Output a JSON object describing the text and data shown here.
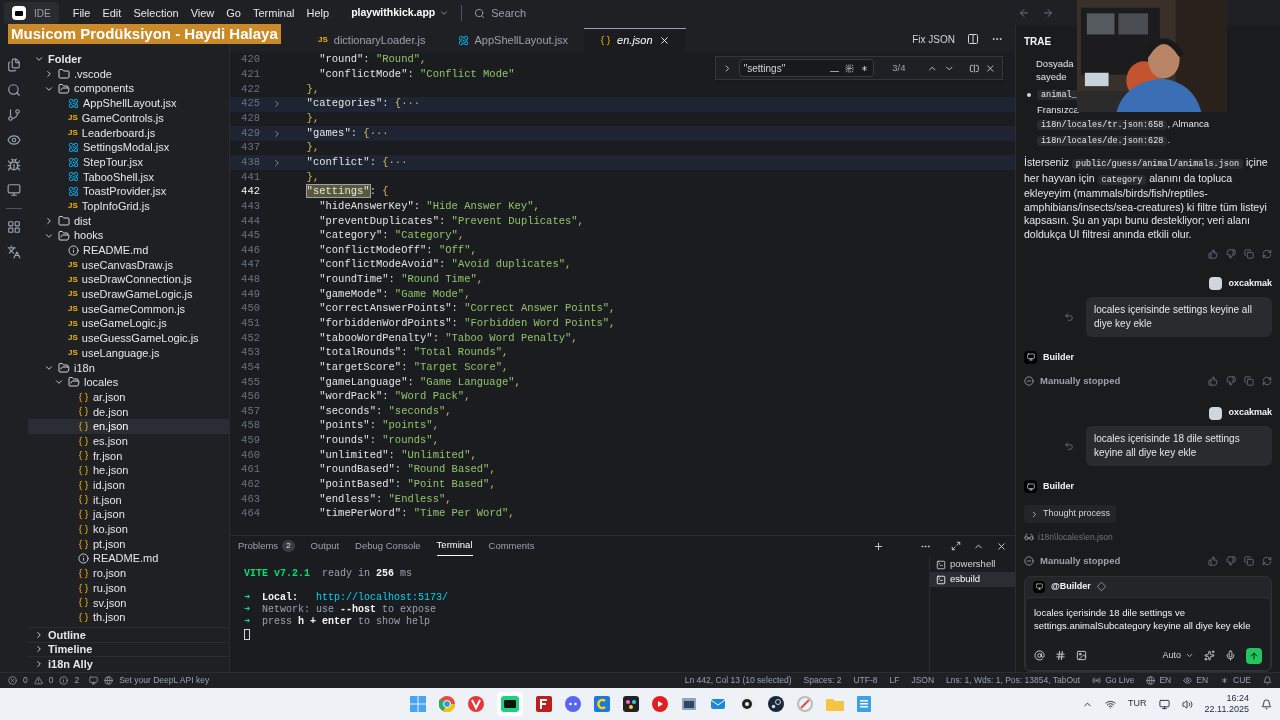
{
  "menubar": {
    "app": "IDE",
    "menus": [
      "File",
      "Edit",
      "Selection",
      "View",
      "Go",
      "Terminal",
      "Help"
    ],
    "project": "playwithkick.app",
    "search_placeholder": "Search"
  },
  "overlay_banner": "Musicom Prodüksiyon - Haydi Halaya",
  "explorer": {
    "tree": [
      {
        "label": "Folder",
        "kind": "root",
        "expanded": true,
        "selected": false,
        "children": [
          {
            "label": ".vscode",
            "kind": "folder",
            "expanded": false,
            "selected": false
          },
          {
            "label": "components",
            "kind": "folder",
            "expanded": true,
            "selected": false,
            "children": [
              {
                "label": "AppShellLayout.jsx",
                "kind": "jsx",
                "selected": false
              },
              {
                "label": "GameControls.js",
                "kind": "js",
                "icon_text": "JS",
                "selected": false
              },
              {
                "label": "Leaderboard.js",
                "kind": "js",
                "icon_text": "JS",
                "selected": false
              },
              {
                "label": "SettingsModal.jsx",
                "kind": "jsx",
                "selected": false
              },
              {
                "label": "StepTour.jsx",
                "kind": "jsx",
                "selected": false
              },
              {
                "label": "TabooShell.jsx",
                "kind": "jsx",
                "selected": false
              },
              {
                "label": "ToastProvider.jsx",
                "kind": "jsx",
                "selected": false
              },
              {
                "label": "TopInfoGrid.js",
                "kind": "js",
                "icon_text": "JS",
                "selected": false
              }
            ]
          },
          {
            "label": "dist",
            "kind": "folder",
            "expanded": false,
            "selected": false
          },
          {
            "label": "hooks",
            "kind": "folder",
            "expanded": true,
            "selected": false,
            "children": [
              {
                "label": "README.md",
                "kind": "md",
                "selected": false
              },
              {
                "label": "useCanvasDraw.js",
                "kind": "js",
                "icon_text": "JS",
                "selected": false
              },
              {
                "label": "useDrawConnection.js",
                "kind": "js",
                "icon_text": "JS",
                "selected": false
              },
              {
                "label": "useDrawGameLogic.js",
                "kind": "js",
                "icon_text": "JS",
                "selected": false
              },
              {
                "label": "useGameCommon.js",
                "kind": "js",
                "icon_text": "JS",
                "selected": false
              },
              {
                "label": "useGameLogic.js",
                "kind": "js",
                "icon_text": "JS",
                "selected": false
              },
              {
                "label": "useGuessGameLogic.js",
                "kind": "js",
                "icon_text": "JS",
                "selected": false
              },
              {
                "label": "useLanguage.js",
                "kind": "js",
                "icon_text": "JS",
                "selected": false
              }
            ]
          },
          {
            "label": "i18n",
            "kind": "folder",
            "expanded": true,
            "selected": false,
            "children": [
              {
                "label": "locales",
                "kind": "folder",
                "expanded": true,
                "selected": false,
                "children": [
                  {
                    "label": "ar.json",
                    "kind": "json",
                    "selected": false
                  },
                  {
                    "label": "de.json",
                    "kind": "json",
                    "selected": false
                  },
                  {
                    "label": "en.json",
                    "kind": "json",
                    "selected": true
                  },
                  {
                    "label": "es.json",
                    "kind": "json",
                    "selected": false
                  },
                  {
                    "label": "fr.json",
                    "kind": "json",
                    "selected": false
                  },
                  {
                    "label": "he.json",
                    "kind": "json",
                    "selected": false
                  },
                  {
                    "label": "id.json",
                    "kind": "json",
                    "selected": false
                  },
                  {
                    "label": "it.json",
                    "kind": "json",
                    "selected": false
                  },
                  {
                    "label": "ja.json",
                    "kind": "json",
                    "selected": false
                  },
                  {
                    "label": "ko.json",
                    "kind": "json",
                    "selected": false
                  },
                  {
                    "label": "pt.json",
                    "kind": "json",
                    "selected": false
                  },
                  {
                    "label": "README.md",
                    "kind": "md",
                    "selected": false
                  },
                  {
                    "label": "ro.json",
                    "kind": "json",
                    "selected": false
                  },
                  {
                    "label": "ru.json",
                    "kind": "json",
                    "selected": false
                  },
                  {
                    "label": "sv.json",
                    "kind": "json",
                    "selected": false
                  },
                  {
                    "label": "th.json",
                    "kind": "json",
                    "selected": false
                  }
                ]
              }
            ]
          }
        ]
      }
    ],
    "sections": [
      {
        "label": "Outline",
        "expanded": false
      },
      {
        "label": "Timeline",
        "expanded": false
      },
      {
        "label": "i18n Ally",
        "expanded": false
      }
    ]
  },
  "editor": {
    "tabs": [
      {
        "label": "dictionaryLoader.js",
        "kind": "js",
        "icon_text": "JS",
        "selected": false
      },
      {
        "label": "AppShellLayout.jsx",
        "kind": "jsx",
        "selected": false
      },
      {
        "label": "en.json",
        "kind": "json",
        "selected": true
      }
    ],
    "fix_label": "Fix JSON",
    "find": {
      "value": "\"settings\"",
      "count": "3/4"
    },
    "lines": [
      {
        "num": "420",
        "text": "    \"round\": \"Round\","
      },
      {
        "num": "421",
        "text": "    \"conflictMode\": \"Conflict Mode\""
      },
      {
        "num": "422",
        "text": "  },"
      },
      {
        "num": "425",
        "text": "  \"categories\": {···",
        "folded": true
      },
      {
        "num": "428",
        "text": "  },"
      },
      {
        "num": "429",
        "text": "  \"games\": {···",
        "folded": true
      },
      {
        "num": "437",
        "text": "  },"
      },
      {
        "num": "438",
        "text": "  \"conflict\": {···",
        "folded": true
      },
      {
        "num": "441",
        "text": "  },"
      },
      {
        "num": "442",
        "text": "  \"settings\": {",
        "current": true,
        "match": true
      },
      {
        "num": "443",
        "text": "    \"hideAnswerKey\": \"Hide Answer Key\","
      },
      {
        "num": "444",
        "text": "    \"preventDuplicates\": \"Prevent Duplicates\","
      },
      {
        "num": "445",
        "text": "    \"category\": \"Category\","
      },
      {
        "num": "446",
        "text": "    \"conflictModeOff\": \"Off\","
      },
      {
        "num": "447",
        "text": "    \"conflictModeAvoid\": \"Avoid duplicates\","
      },
      {
        "num": "448",
        "text": "    \"roundTime\": \"Round Time\","
      },
      {
        "num": "449",
        "text": "    \"gameMode\": \"Game Mode\","
      },
      {
        "num": "450",
        "text": "    \"correctAnswerPoints\": \"Correct Answer Points\","
      },
      {
        "num": "451",
        "text": "    \"forbiddenWordPoints\": \"Forbidden Word Points\","
      },
      {
        "num": "452",
        "text": "    \"tabooWordPenalty\": \"Taboo Word Penalty\","
      },
      {
        "num": "453",
        "text": "    \"totalRounds\": \"Total Rounds\","
      },
      {
        "num": "454",
        "text": "    \"targetScore\": \"Target Score\","
      },
      {
        "num": "455",
        "text": "    \"gameLanguage\": \"Game Language\","
      },
      {
        "num": "456",
        "text": "    \"wordPack\": \"Word Pack\","
      },
      {
        "num": "457",
        "text": "    \"seconds\": \"seconds\","
      },
      {
        "num": "458",
        "text": "    \"points\": \"points\","
      },
      {
        "num": "459",
        "text": "    \"rounds\": \"rounds\","
      },
      {
        "num": "460",
        "text": "    \"unlimited\": \"Unlimited\","
      },
      {
        "num": "461",
        "text": "    \"roundBased\": \"Round Based\","
      },
      {
        "num": "462",
        "text": "    \"pointBased\": \"Point Based\","
      },
      {
        "num": "463",
        "text": "    \"endless\": \"Endless\","
      },
      {
        "num": "464",
        "text": "    \"timePerWord\": \"Time Per Word\","
      }
    ]
  },
  "panel": {
    "tabs": [
      {
        "label": "Problems",
        "badge": "2",
        "selected": false
      },
      {
        "label": "Output",
        "selected": false
      },
      {
        "label": "Debug Console",
        "selected": false
      },
      {
        "label": "Terminal",
        "selected": true
      },
      {
        "label": "Comments",
        "selected": false
      }
    ],
    "terminal_lines": [
      [
        {
          "text": "VITE v7.2.1",
          "kind": "accent"
        },
        {
          "text": "  ready in ",
          "kind": "dim"
        },
        {
          "text": "256",
          "kind": "bold"
        },
        {
          "text": " ms",
          "kind": "dim"
        }
      ],
      [
        {
          "text": "➜",
          "kind": "accent"
        },
        {
          "text": "  Local:   ",
          "kind": "bold"
        },
        {
          "text": "http://localhost:5173/",
          "kind": "link"
        }
      ],
      [
        {
          "text": "➜",
          "kind": "accent"
        },
        {
          "text": "  Network: use ",
          "kind": "dim"
        },
        {
          "text": "--host",
          "kind": "bold"
        },
        {
          "text": " to expose",
          "kind": "dim"
        }
      ],
      [
        {
          "text": "➜",
          "kind": "accent"
        },
        {
          "text": "  press ",
          "kind": "dim"
        },
        {
          "text": "h + enter",
          "kind": "bold"
        },
        {
          "text": " to show help",
          "kind": "dim"
        }
      ]
    ],
    "terminals": [
      {
        "label": "powershell",
        "selected": false
      },
      {
        "label": "esbuild",
        "selected": true
      }
    ]
  },
  "chat": {
    "title": "TRAE",
    "items": [
      {
        "kind": "lines",
        "lines": [
          "Dosyada",
          "sayede"
        ]
      },
      {
        "kind": "bullet",
        "lines": [
          [
            {
              "text": "animal_",
              "code": true
            }
          ],
          [
            {
              "text": "Fransızca",
              "code": false
            }
          ],
          [
            {
              "text": "i18n/locales/tr.json:658",
              "code": true
            },
            {
              "text": ", Almanca",
              "code": false
            }
          ],
          [
            {
              "text": "i18n/locales/de.json:628",
              "code": true
            },
            {
              "text": ".",
              "code": false
            }
          ]
        ]
      },
      {
        "kind": "paragraph",
        "segments": [
          {
            "text": "İsterseniz ",
            "code": false
          },
          {
            "text": "public/guess/animal/animals.json",
            "code": true
          },
          {
            "text": " içine her hayvan için ",
            "code": false
          },
          {
            "text": "category",
            "code": true
          },
          {
            "text": " alanını da topluca ekleyeyim (mammals/birds/fish/reptiles-amphibians/insects/sea-creatures) ki filtre tüm listeyi kapsasın. Şu an yapı bunu destekliyor; veri alanı doldukça UI filtresi anında etkili olur.",
            "code": false
          }
        ]
      },
      {
        "kind": "actions"
      },
      {
        "kind": "user",
        "name": "oxcakmak",
        "text": "locales içerisinde settings keyine all diye key ekle"
      },
      {
        "kind": "bot",
        "name": "Builder"
      },
      {
        "kind": "status",
        "text": "Manually stopped"
      },
      {
        "kind": "user",
        "name": "oxcakmak",
        "text": "locales içerisinde 18 dile settings keyine all diye key ekle"
      },
      {
        "kind": "bot",
        "name": "Builder"
      },
      {
        "kind": "thought",
        "text": "Thought process",
        "expanded": false
      },
      {
        "kind": "file",
        "text": "i18n\\locales\\en.json"
      },
      {
        "kind": "status",
        "text": "Manually stopped"
      }
    ],
    "composer": {
      "agent": "@Builder",
      "value": "locales içerisinde 18 dile settings ve settings.animalSubcategory keyine all diye key ekle",
      "mode": "Auto"
    }
  },
  "status_bar": {
    "errors": "0",
    "warnings": "0",
    "infos": "2",
    "deepl": "Set your DeepL API key",
    "right": [
      {
        "text": "Ln 442, Col 13 (10 selected)",
        "kind": "text"
      },
      {
        "text": "Spaces: 2",
        "kind": "text"
      },
      {
        "text": "UTF-8",
        "kind": "text"
      },
      {
        "text": "LF",
        "kind": "text"
      },
      {
        "text": "JSON",
        "kind": "text"
      },
      {
        "text": "Lns: 1, Wds: 1, Pos: 13854, TabOut",
        "kind": "text"
      },
      {
        "text": "Go Live",
        "kind": "live"
      },
      {
        "text": "EN",
        "kind": "globe"
      },
      {
        "text": "EN",
        "kind": "eye"
      },
      {
        "text": "CUE",
        "kind": "cue"
      }
    ]
  },
  "taskbar": {
    "language": "TUR",
    "time": "16:24",
    "date": "22.11.2025"
  }
}
